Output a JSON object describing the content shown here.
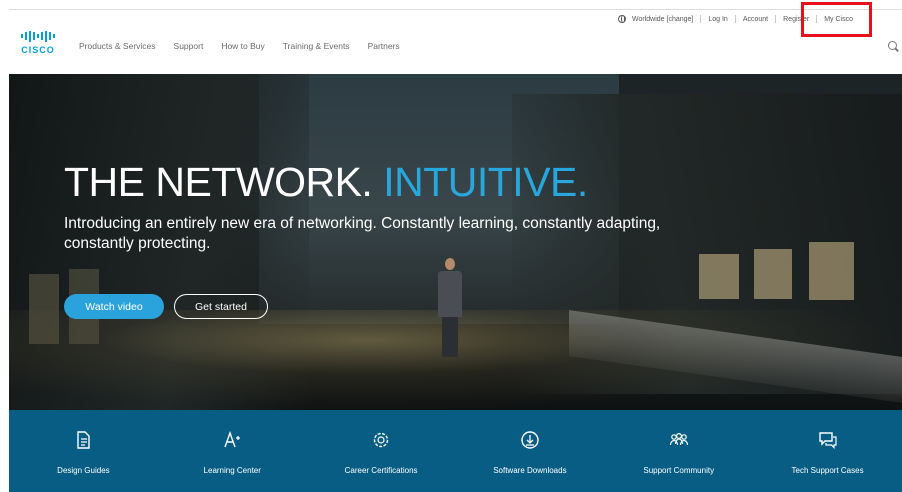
{
  "header": {
    "brand": "CISCO",
    "utility": {
      "worldwide": "Worldwide [change]",
      "login": "Log In",
      "account": "Account",
      "register": "Register",
      "my_cisco": "My Cisco"
    },
    "nav": [
      {
        "label": "Products & Services"
      },
      {
        "label": "Support"
      },
      {
        "label": "How to Buy"
      },
      {
        "label": "Training & Events"
      },
      {
        "label": "Partners"
      }
    ],
    "highlight_color": "#e8101a"
  },
  "hero": {
    "title_main": "THE NETWORK. ",
    "title_accent": "INTUITIVE.",
    "subtitle": "Introducing an entirely new era of networking. Constantly learning, constantly adapting, constantly protecting.",
    "watch_button": "Watch video",
    "start_button": "Get started",
    "accent_color": "#28a7dd"
  },
  "quick_links": [
    {
      "label": "Design Guides",
      "icon": "document-icon"
    },
    {
      "label": "Learning Center",
      "icon": "learning-icon"
    },
    {
      "label": "Career Certifications",
      "icon": "certificate-icon"
    },
    {
      "label": "Software Downloads",
      "icon": "download-icon"
    },
    {
      "label": "Support Community",
      "icon": "community-icon"
    },
    {
      "label": "Tech Support Cases",
      "icon": "chat-icon"
    }
  ],
  "colors": {
    "brand_blue": "#049fd9",
    "quick_bar": "#075d84"
  }
}
